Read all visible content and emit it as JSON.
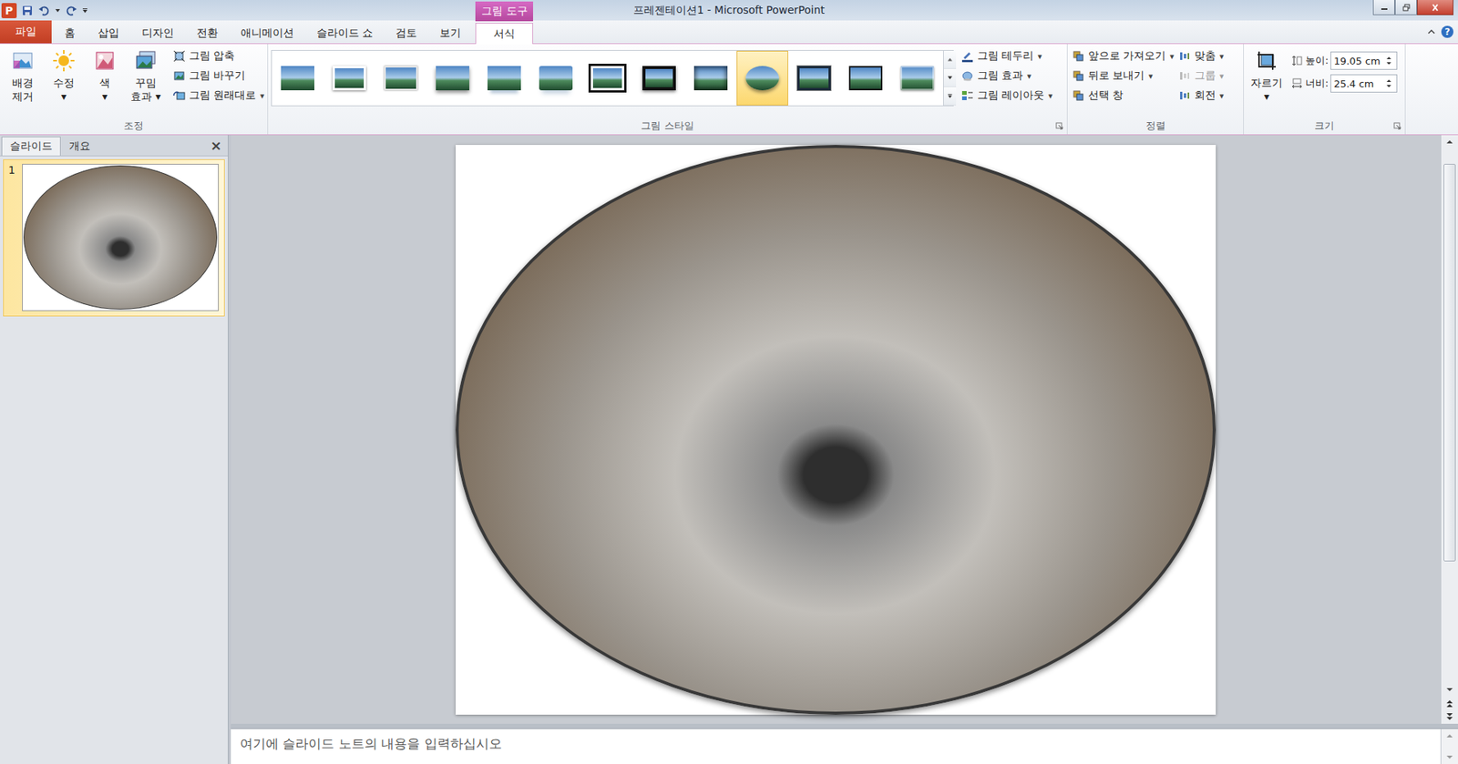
{
  "window": {
    "app_icon": "P",
    "title": "프레젠테이션1 - Microsoft PowerPoint",
    "context_label": "그림 도구"
  },
  "tabs": [
    {
      "label": "파일",
      "selected": false,
      "kind": "file"
    },
    {
      "label": "홈",
      "selected": false,
      "kind": "normal"
    },
    {
      "label": "삽입",
      "selected": false,
      "kind": "normal"
    },
    {
      "label": "디자인",
      "selected": false,
      "kind": "normal"
    },
    {
      "label": "전환",
      "selected": false,
      "kind": "normal"
    },
    {
      "label": "애니메이션",
      "selected": false,
      "kind": "normal"
    },
    {
      "label": "슬라이드 쇼",
      "selected": false,
      "kind": "normal"
    },
    {
      "label": "검토",
      "selected": false,
      "kind": "normal"
    },
    {
      "label": "보기",
      "selected": false,
      "kind": "normal"
    },
    {
      "label": "서식",
      "selected": true,
      "kind": "context"
    }
  ],
  "help": "?",
  "adjust": {
    "label": "조정",
    "large": [
      {
        "lines": [
          "배경",
          "제거"
        ]
      },
      {
        "lines": [
          "수정",
          "▾"
        ]
      },
      {
        "lines": [
          "색",
          "▾"
        ]
      },
      {
        "lines": [
          "꾸밈",
          "효과 ▾"
        ]
      }
    ],
    "small": [
      {
        "label": "그림 압축",
        "arrow": ""
      },
      {
        "label": "그림 바꾸기",
        "arrow": ""
      },
      {
        "label": "그림 원래대로",
        "arrow": "▾"
      }
    ]
  },
  "styles": {
    "label": "그림 스타일",
    "gallery": [
      {
        "kind": "simple",
        "selected": false
      },
      {
        "kind": "white-frame",
        "selected": false
      },
      {
        "kind": "thin-frame",
        "selected": false
      },
      {
        "kind": "soft-shadow",
        "selected": false
      },
      {
        "kind": "reflected",
        "selected": false
      },
      {
        "kind": "reflected-soft",
        "selected": false
      },
      {
        "kind": "black-frame",
        "selected": false
      },
      {
        "kind": "black-frame-shadow",
        "selected": false
      },
      {
        "kind": "dark-edge",
        "selected": false
      },
      {
        "kind": "oval",
        "selected": true
      },
      {
        "kind": "dark-frame",
        "selected": false
      },
      {
        "kind": "dark-thin",
        "selected": false
      },
      {
        "kind": "beveled",
        "selected": false
      }
    ],
    "commands": [
      {
        "label": "그림 테두리",
        "arrow": "▾"
      },
      {
        "label": "그림 효과",
        "arrow": "▾"
      },
      {
        "label": "그림 레이아웃",
        "arrow": "▾"
      }
    ]
  },
  "arrange": {
    "label": "정렬",
    "columns": [
      [
        {
          "label": "앞으로 가져오기",
          "arrow": "▾",
          "disabled": false
        },
        {
          "label": "뒤로 보내기",
          "arrow": "▾",
          "disabled": false
        },
        {
          "label": "선택 창",
          "arrow": "",
          "disabled": false
        }
      ],
      [
        {
          "label": "맞춤",
          "arrow": "▾",
          "disabled": false
        },
        {
          "label": "그룹",
          "arrow": "▾",
          "disabled": true
        },
        {
          "label": "회전",
          "arrow": "▾",
          "disabled": false
        }
      ]
    ]
  },
  "size": {
    "label": "크기",
    "crop": {
      "lines": [
        "자르기",
        "▾"
      ]
    },
    "fields": [
      {
        "label": "높이:",
        "value": "19.05 cm"
      },
      {
        "label": "너비:",
        "value": "25.4 cm"
      }
    ]
  },
  "slide_panel": {
    "tabs": [
      {
        "label": "슬라이드",
        "selected": true
      },
      {
        "label": "개요",
        "selected": false
      }
    ],
    "close": "×",
    "slides": [
      {
        "number": "1",
        "selected": true
      }
    ]
  },
  "notes": {
    "placeholder": "여기에 슬라이드 노트의 내용을 입력하십시오"
  }
}
